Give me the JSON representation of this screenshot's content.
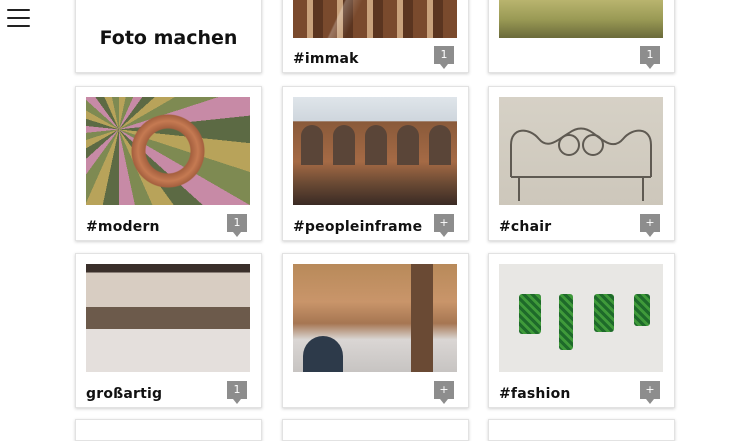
{
  "menu": {
    "icon": "hamburger-menu-icon"
  },
  "cards": [
    {
      "id": "take-photo",
      "label": "Foto machen"
    },
    {
      "id": "immak",
      "tag": "#immak",
      "badge": "1"
    },
    {
      "id": "top-right",
      "tag": "",
      "badge": "1"
    },
    {
      "id": "modern",
      "tag": "#modern",
      "badge": "1"
    },
    {
      "id": "peopleinframe",
      "tag": "#peopleinframe",
      "badge": "+"
    },
    {
      "id": "chair",
      "tag": "#chair",
      "badge": "+"
    },
    {
      "id": "grossartig",
      "tag": "großartig",
      "badge": "1"
    },
    {
      "id": "hall",
      "tag": "",
      "badge": "+"
    },
    {
      "id": "fashion",
      "tag": "#fashion",
      "badge": "+"
    }
  ]
}
